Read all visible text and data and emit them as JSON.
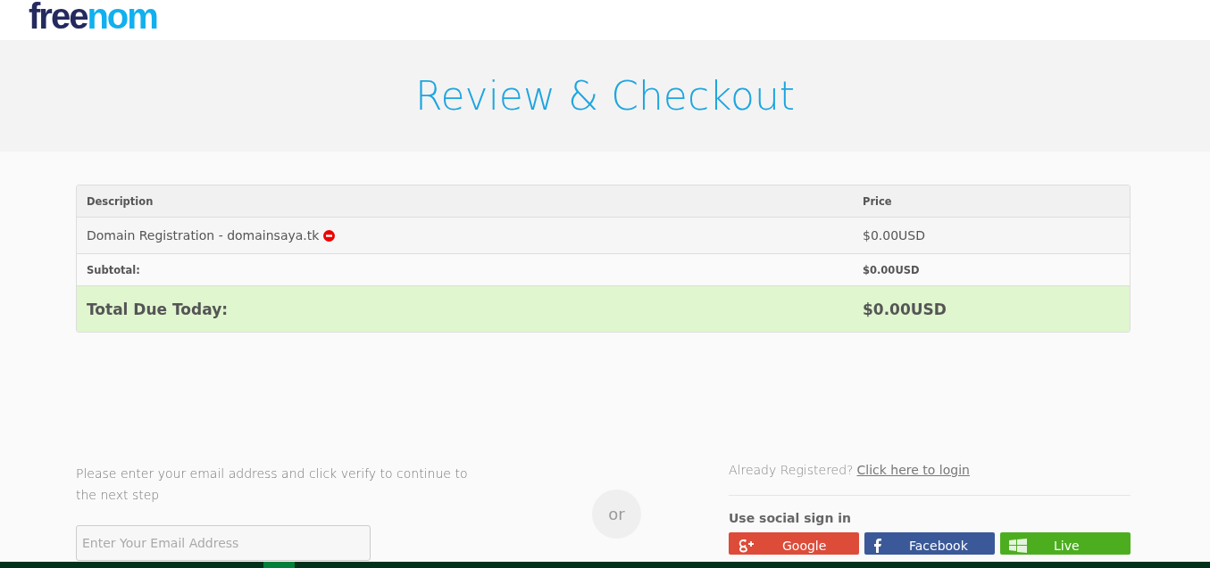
{
  "logo": {
    "part_1": "free",
    "part_2": "nom"
  },
  "title": "Review & Checkout",
  "table": {
    "columns": [
      "Description",
      "Price"
    ],
    "rows": [
      {
        "kind": "item",
        "description": "Domain Registration - domainsaya.tk",
        "price": "$0.00USD",
        "removable": true
      },
      {
        "kind": "subtotal",
        "description": "Subtotal:",
        "price": "$0.00USD"
      },
      {
        "kind": "total",
        "description": "Total Due Today:",
        "price": "$0.00USD"
      }
    ]
  },
  "email": {
    "prompt": "Please enter your email address and click verify to continue to the next step",
    "placeholder": "Enter Your Email Address"
  },
  "separator": "or",
  "login": {
    "question": "Already Registered?",
    "link": "Click here to login"
  },
  "social": {
    "heading": "Use social sign in",
    "buttons": [
      {
        "kind": "google",
        "label": "Google"
      },
      {
        "kind": "facebook",
        "label": "Facebook"
      },
      {
        "kind": "live",
        "label": "Live"
      }
    ]
  }
}
